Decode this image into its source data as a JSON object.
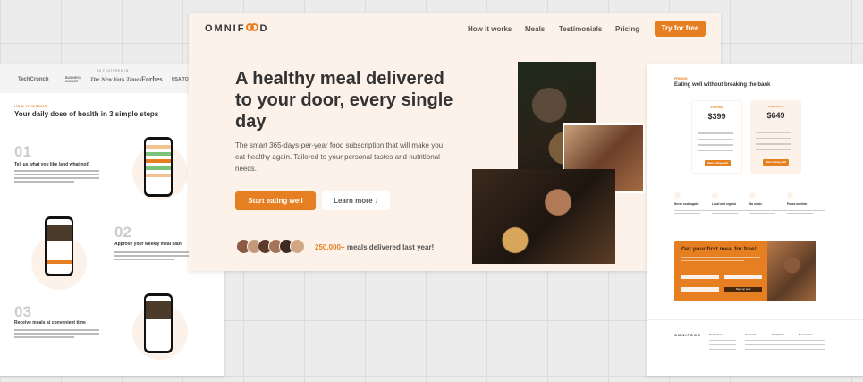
{
  "hero": {
    "logo": "OMNIF",
    "logo_tail": "D",
    "nav": [
      "How it works",
      "Meals",
      "Testimonials",
      "Pricing"
    ],
    "cta": "Try for free",
    "title": "A healthy meal delivered to your door, every single day",
    "description": "The smart 365-days-per-year food subscription that will make you eat healthy again. Tailored to your personal tastes and nutritional needs.",
    "primary_button": "Start eating well",
    "secondary_button": "Learn more ↓",
    "delivered_count": "250,000+",
    "delivered_text": "meals delivered last year!",
    "avatar_colors": [
      "#8a5a44",
      "#c29a7b",
      "#5d3b2a",
      "#a67458",
      "#3f2a20",
      "#d2a785"
    ]
  },
  "steps": {
    "press_label": "AS FEATURED IN",
    "press_logos": [
      "TechCrunch",
      "BUSINESS INSIDER",
      "The New York Times",
      "Forbes",
      "USA TODAY"
    ],
    "sub_heading": "HOW IT WORKS",
    "title": "Your daily dose of health in 3 simple steps",
    "items": [
      {
        "num": "01",
        "title": "Tell us what you like (and what not)"
      },
      {
        "num": "02",
        "title": "Approve your weekly meal plan"
      },
      {
        "num": "03",
        "title": "Receive meals at convenient time"
      }
    ]
  },
  "pricing": {
    "sub_heading": "PRICING",
    "title": "Eating well without breaking the bank",
    "plans": [
      {
        "name": "STARTER",
        "price": "$399",
        "button": "Start eating well"
      },
      {
        "name": "COMPLETE",
        "price": "$649",
        "button": "Start eating well"
      }
    ],
    "features": [
      "Never cook again!",
      "Local and organic",
      "No waste",
      "Pause anytime"
    ],
    "cta_title": "Get your first meal for free!",
    "cta_button": "Sign up now",
    "footer_logo": "OMNIF",
    "footer_logo_tail": "D",
    "footer_cols": [
      "Contact us",
      "Account",
      "Company",
      "Resources"
    ]
  },
  "colors": {
    "accent": "#e67e22",
    "tint": "#fdf2e9",
    "dark": "#333333"
  }
}
